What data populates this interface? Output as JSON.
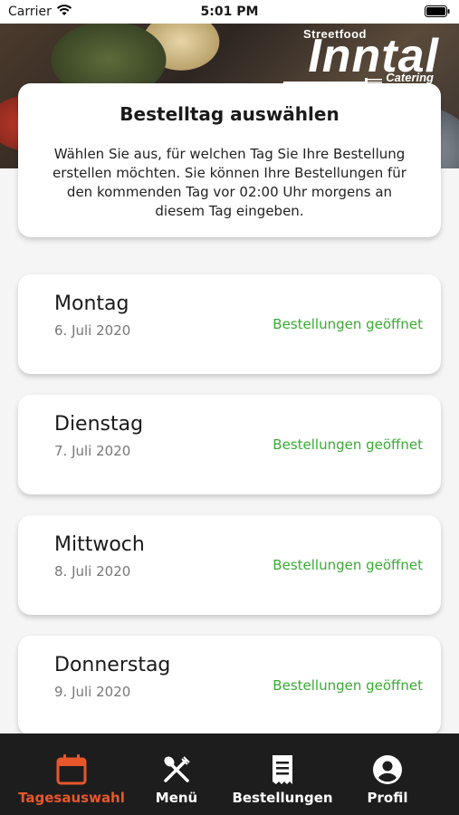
{
  "status_bar": {
    "carrier": "Carrier",
    "time": "5:01 PM"
  },
  "logo": {
    "top": "Streetfood",
    "main": "Inntal",
    "bottom": "Catering"
  },
  "intro": {
    "title": "Bestelltag auswählen",
    "description": "Wählen Sie aus, für welchen Tag Sie Ihre Bestellung erstellen möchten. Sie können Ihre Bestellungen für den kommenden Tag vor 02:00 Uhr morgens an diesem Tag eingeben."
  },
  "days": [
    {
      "day": "Montag",
      "date": "6. Juli 2020",
      "status": "Bestellungen geöffnet"
    },
    {
      "day": "Dienstag",
      "date": "7. Juli 2020",
      "status": "Bestellungen geöffnet"
    },
    {
      "day": "Mittwoch",
      "date": "8. Juli 2020",
      "status": "Bestellungen geöffnet"
    },
    {
      "day": "Donnerstag",
      "date": "9. Juli 2020",
      "status": "Bestellungen geöffnet"
    }
  ],
  "colors": {
    "accent": "#e8572b",
    "open_status": "#3aaa35",
    "tab_bar": "#1d1d1d"
  },
  "tabs": [
    {
      "label": "Tagesauswahl",
      "icon": "calendar-icon",
      "active": true
    },
    {
      "label": "Menü",
      "icon": "fork-knife-icon",
      "active": false
    },
    {
      "label": "Bestellungen",
      "icon": "receipt-icon",
      "active": false
    },
    {
      "label": "Profil",
      "icon": "profile-icon",
      "active": false
    }
  ]
}
